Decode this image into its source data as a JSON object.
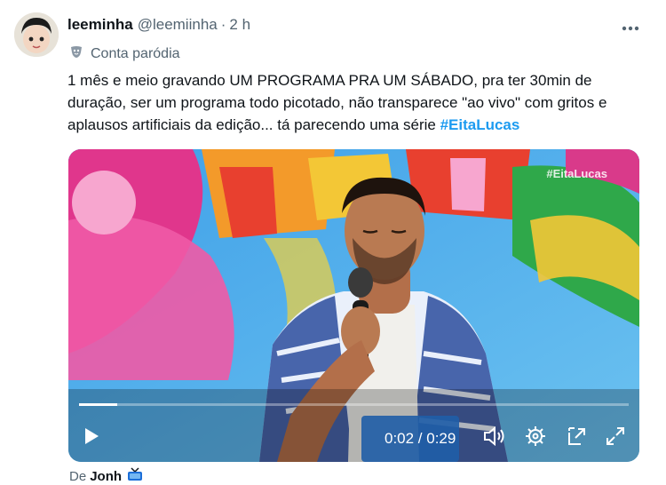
{
  "tweet": {
    "author_name": "leeminha",
    "author_handle": "@leemiinha",
    "separator": "·",
    "timestamp": "2 h",
    "parody_label": "Conta paródia",
    "text_before": "1 mês e meio gravando UM PROGRAMA PRA UM SÁBADO, pra ter 30min de duração, ser um programa todo picotado, não transparece \"ao vivo\" com gritos e aplausos artificiais da edição... tá parecendo uma série ",
    "hashtag": "#EitaLucas"
  },
  "video": {
    "watermark": "#EitaLucas",
    "current_time": "0:02",
    "duration": "0:29",
    "time_display": "0:02 / 0:29",
    "progress": 0.07
  },
  "credit": {
    "prefix": "De",
    "user": "Jonh"
  },
  "icons": {
    "more": "more-horizontal-icon",
    "parody": "parody-mask-icon",
    "play": "play-icon",
    "volume": "volume-icon",
    "settings": "gear-icon",
    "pip": "picture-in-picture-icon",
    "fullscreen": "fullscreen-icon",
    "tv": "tv-icon"
  },
  "colors": {
    "accent": "#1d9bf0",
    "secondary_text": "#536471",
    "primary_text": "#0f1419"
  }
}
